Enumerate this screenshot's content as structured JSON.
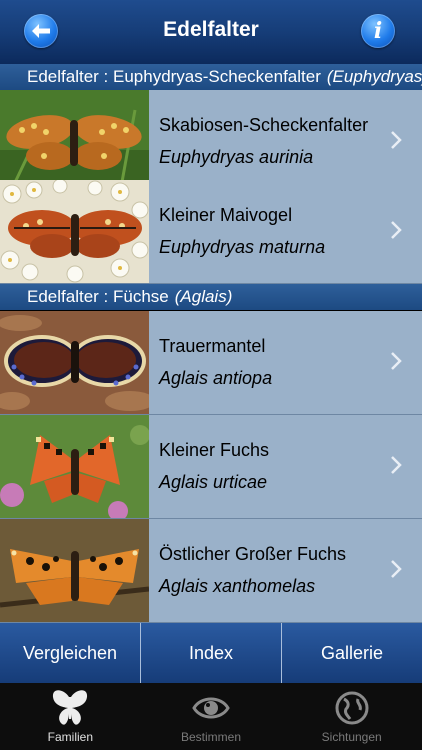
{
  "navbar": {
    "title": "Edelfalter"
  },
  "sections": [
    {
      "header": "Edelfalter : Euphydryas-Scheckenfalter",
      "header_sci": "(Euphydryas)",
      "rows": [
        {
          "name": "Skabiosen-Scheckenfalter",
          "scientific": "Euphydryas aurinia"
        },
        {
          "name": "Kleiner Maivogel",
          "scientific": "Euphydryas maturna"
        }
      ]
    },
    {
      "header": "Edelfalter : Füchse",
      "header_sci": "(Aglais)",
      "rows": [
        {
          "name": "Trauermantel",
          "scientific": "Aglais antiopa"
        },
        {
          "name": "Kleiner Fuchs",
          "scientific": "Aglais urticae"
        },
        {
          "name": "Östlicher Großer Fuchs",
          "scientific": "Aglais xanthomelas"
        }
      ]
    }
  ],
  "bottom_buttons": [
    "Vergleichen",
    "Index",
    "Gallerie"
  ],
  "tabs": [
    {
      "label": "Familien",
      "icon": "butterfly-icon",
      "active": true
    },
    {
      "label": "Bestimmen",
      "icon": "eye-icon",
      "active": false
    },
    {
      "label": "Sichtungen",
      "icon": "globe-icon",
      "active": false
    }
  ],
  "colors": {
    "nav": "#163d78",
    "row": "#9ab1c9",
    "section": "#1d4a82",
    "tabbar": "#0d0d0d"
  }
}
